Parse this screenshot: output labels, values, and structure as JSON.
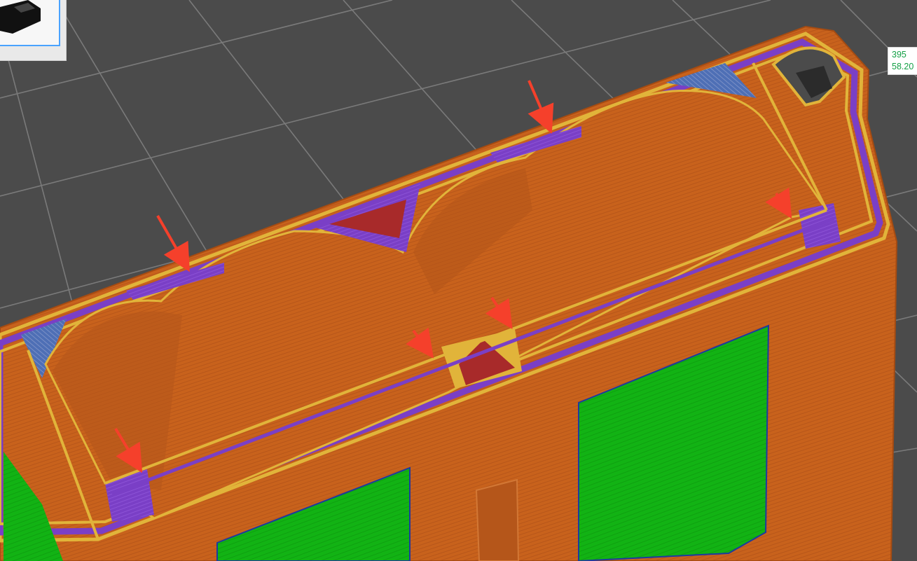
{
  "viewport": {
    "background": "#4b4b4b",
    "grid_color": "#7a7a7a",
    "colors": {
      "wall_outer": "#c8621c",
      "wall_inner": "#e1b43a",
      "infill_purple": "#7a3fc6",
      "top_solid_blue": "#4e6fb5",
      "support_green": "#12b314",
      "bridge_red": "#a82a2a",
      "arrow_red": "#f5402b"
    }
  },
  "thumbnail": {
    "icon": "model-thumbnail-icon",
    "border_color": "#4aa3ff"
  },
  "readout": {
    "line1": "395",
    "line2": "58.20",
    "color": "#14a046"
  }
}
